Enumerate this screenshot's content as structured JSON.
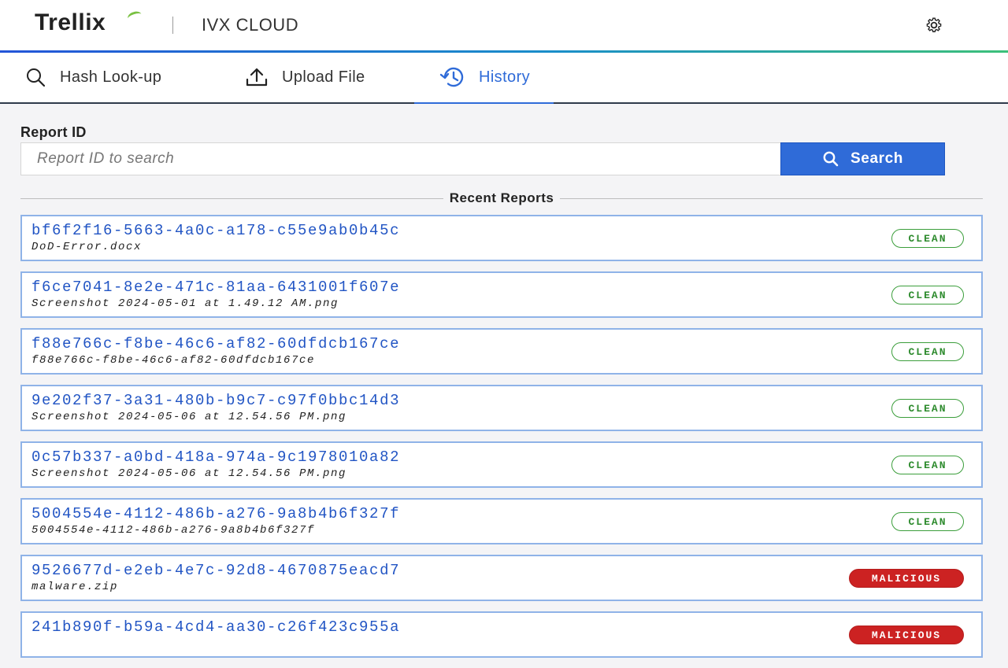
{
  "header": {
    "logo_text": "Trellix",
    "product_name": "IVX CLOUD",
    "settings_icon": "gear-icon"
  },
  "tabs": [
    {
      "label": "Hash Look-up",
      "icon": "search-icon",
      "active": false
    },
    {
      "label": "Upload File",
      "icon": "upload-icon",
      "active": false
    },
    {
      "label": "History",
      "icon": "history-icon",
      "active": true
    }
  ],
  "search": {
    "label": "Report ID",
    "placeholder": "Report ID to search",
    "value": "",
    "button_label": "Search"
  },
  "recent": {
    "title": "Recent Reports",
    "items": [
      {
        "id": "bf6f2f16-5663-4a0c-a178-c55e9ab0b45c",
        "file": "DoD-Error.docx",
        "status": "CLEAN"
      },
      {
        "id": "f6ce7041-8e2e-471c-81aa-6431001f607e",
        "file": "Screenshot 2024-05-01 at 1.49.12 AM.png",
        "status": "CLEAN"
      },
      {
        "id": "f88e766c-f8be-46c6-af82-60dfdcb167ce",
        "file": "f88e766c-f8be-46c6-af82-60dfdcb167ce",
        "status": "CLEAN"
      },
      {
        "id": "9e202f37-3a31-480b-b9c7-c97f0bbc14d3",
        "file": "Screenshot 2024-05-06 at 12.54.56 PM.png",
        "status": "CLEAN"
      },
      {
        "id": "0c57b337-a0bd-418a-974a-9c1978010a82",
        "file": "Screenshot 2024-05-06 at 12.54.56 PM.png",
        "status": "CLEAN"
      },
      {
        "id": "5004554e-4112-486b-a276-9a8b4b6f327f",
        "file": "5004554e-4112-486b-a276-9a8b4b6f327f",
        "status": "CLEAN"
      },
      {
        "id": "9526677d-e2eb-4e7c-92d8-4670875eacd7",
        "file": "malware.zip",
        "status": "MALICIOUS"
      },
      {
        "id": "241b890f-b59a-4cd4-aa30-c26f423c955a",
        "file": "",
        "status": "MALICIOUS"
      }
    ]
  },
  "colors": {
    "accent": "#2f6bd8",
    "clean": "#2e8b2e",
    "malicious": "#cc2222",
    "card_border": "#8fb3e8"
  }
}
